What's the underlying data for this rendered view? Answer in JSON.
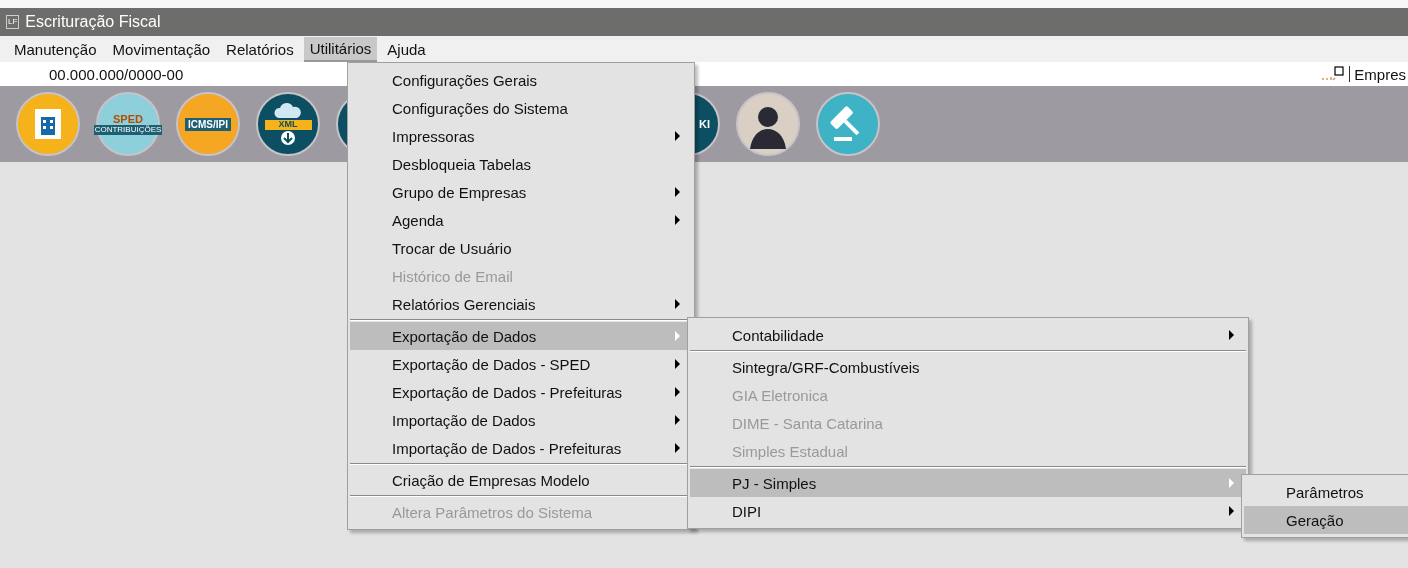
{
  "window": {
    "app_icon": "LF",
    "title": "Escrituração Fiscal"
  },
  "menubar": [
    {
      "label": "Manutenção",
      "selected": false
    },
    {
      "label": "Movimentação",
      "selected": false
    },
    {
      "label": "Relatórios",
      "selected": false
    },
    {
      "label": "Utilitários",
      "selected": true
    },
    {
      "label": "Ajuda",
      "selected": false
    }
  ],
  "info_bar": {
    "cnpj": "00.000.000/0000-00",
    "company": "Empres"
  },
  "toolbar": {
    "left": [
      {
        "kind": "building"
      },
      {
        "kind": "sped",
        "labels": [
          "SPED",
          "CONTRIBUIÇÕES"
        ]
      },
      {
        "kind": "icms",
        "labels": [
          "ICMS/IPI"
        ]
      },
      {
        "kind": "xml",
        "labels": [
          "XML"
        ]
      },
      {
        "kind": "plain"
      }
    ],
    "right": [
      {
        "kind": "ki",
        "labels": [
          "KI"
        ]
      },
      {
        "kind": "avatar"
      },
      {
        "kind": "gavel"
      }
    ]
  },
  "menus": [
    {
      "items": [
        {
          "kind": "item",
          "label": "Configurações Gerais",
          "disabled": false,
          "selected": false,
          "submenu": false
        },
        {
          "kind": "item",
          "label": "Configurações do Sistema",
          "disabled": false,
          "selected": false,
          "submenu": false
        },
        {
          "kind": "item",
          "label": "Impressoras",
          "disabled": false,
          "selected": false,
          "submenu": true
        },
        {
          "kind": "item",
          "label": "Desbloqueia Tabelas",
          "disabled": false,
          "selected": false,
          "submenu": false
        },
        {
          "kind": "item",
          "label": "Grupo de Empresas",
          "disabled": false,
          "selected": false,
          "submenu": true
        },
        {
          "kind": "item",
          "label": "Agenda",
          "disabled": false,
          "selected": false,
          "submenu": true
        },
        {
          "kind": "item",
          "label": "Trocar de Usuário",
          "disabled": false,
          "selected": false,
          "submenu": false
        },
        {
          "kind": "item",
          "label": "Histórico de Email",
          "disabled": true,
          "selected": false,
          "submenu": false
        },
        {
          "kind": "item",
          "label": "Relatórios Gerenciais",
          "disabled": false,
          "selected": false,
          "submenu": true
        },
        {
          "kind": "separator"
        },
        {
          "kind": "item",
          "label": "Exportação de Dados",
          "disabled": false,
          "selected": true,
          "submenu": true
        },
        {
          "kind": "item",
          "label": "Exportação de Dados - SPED",
          "disabled": false,
          "selected": false,
          "submenu": true
        },
        {
          "kind": "item",
          "label": "Exportação de Dados - Prefeituras",
          "disabled": false,
          "selected": false,
          "submenu": true
        },
        {
          "kind": "item",
          "label": "Importação de Dados",
          "disabled": false,
          "selected": false,
          "submenu": true
        },
        {
          "kind": "item",
          "label": "Importação de Dados - Prefeituras",
          "disabled": false,
          "selected": false,
          "submenu": true
        },
        {
          "kind": "separator"
        },
        {
          "kind": "item",
          "label": "Criação de Empresas Modelo",
          "disabled": false,
          "selected": false,
          "submenu": false
        },
        {
          "kind": "separator"
        },
        {
          "kind": "item",
          "label": "Altera Parâmetros do Sistema",
          "disabled": true,
          "selected": false,
          "submenu": false
        }
      ]
    },
    {
      "items": [
        {
          "kind": "item",
          "label": "Contabilidade",
          "disabled": false,
          "selected": false,
          "submenu": true
        },
        {
          "kind": "separator"
        },
        {
          "kind": "item",
          "label": "Sintegra/GRF-Combustíveis",
          "disabled": false,
          "selected": false,
          "submenu": false
        },
        {
          "kind": "item",
          "label": "GIA Eletronica",
          "disabled": true,
          "selected": false,
          "submenu": false
        },
        {
          "kind": "item",
          "label": "DIME - Santa Catarina",
          "disabled": true,
          "selected": false,
          "submenu": false
        },
        {
          "kind": "item",
          "label": "Simples Estadual",
          "disabled": true,
          "selected": false,
          "submenu": false
        },
        {
          "kind": "separator"
        },
        {
          "kind": "item",
          "label": "PJ - Simples",
          "disabled": false,
          "selected": true,
          "submenu": true
        },
        {
          "kind": "item",
          "label": "DIPI",
          "disabled": false,
          "selected": false,
          "submenu": true
        }
      ]
    },
    {
      "items": [
        {
          "kind": "item",
          "label": "Parâmetros",
          "disabled": false,
          "selected": false,
          "submenu": false
        },
        {
          "kind": "item",
          "label": "Geração",
          "disabled": false,
          "selected": true,
          "submenu": false
        }
      ]
    }
  ]
}
